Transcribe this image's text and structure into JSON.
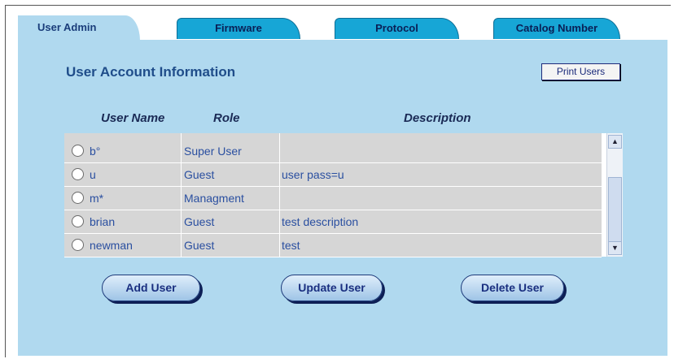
{
  "tabs": [
    {
      "label": "User Admin"
    },
    {
      "label": "Firmware"
    },
    {
      "label": "Protocol"
    },
    {
      "label": "Catalog Number"
    }
  ],
  "section_title": "User Account Information",
  "print_button": "Print Users",
  "columns": {
    "user_name": "User Name",
    "role": "Role",
    "description": "Description"
  },
  "users": [
    {
      "name": "b°",
      "role": "Super User",
      "description": ""
    },
    {
      "name": "u",
      "role": "Guest",
      "description": "user pass=u"
    },
    {
      "name": "m*",
      "role": "Managment",
      "description": ""
    },
    {
      "name": "brian",
      "role": "Guest",
      "description": "test description"
    },
    {
      "name": "newman",
      "role": "Guest",
      "description": "test"
    }
  ],
  "scrollbar": {
    "up_icon": "chevron-up-icon",
    "down_icon": "chevron-down-icon"
  },
  "actions": {
    "add": "Add User",
    "update": "Update User",
    "delete": "Delete User"
  },
  "colors": {
    "panel": "#b0d9ef",
    "tab": "#17a6d6",
    "text_link": "#2a4fa0",
    "grid": "#d6d6d6"
  }
}
